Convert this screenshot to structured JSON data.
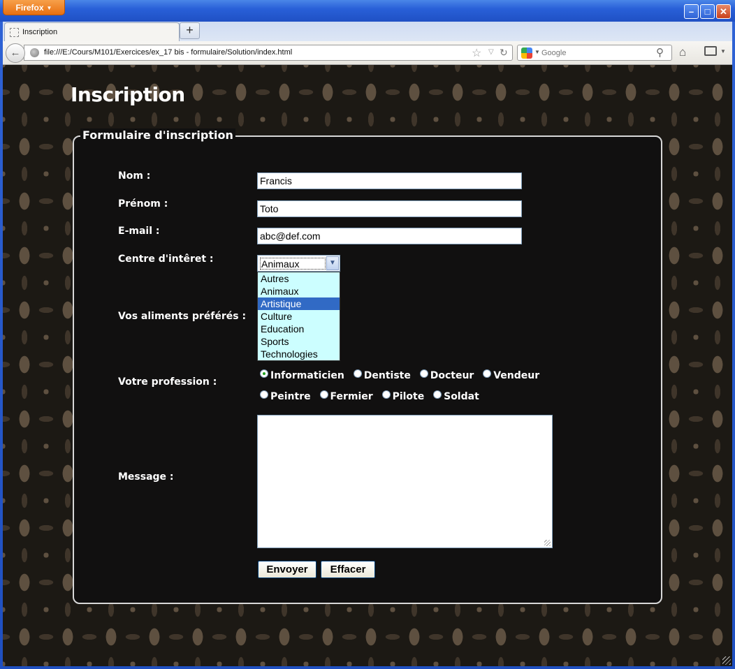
{
  "browser": {
    "app_button": "Firefox",
    "tab_title": "Inscription",
    "new_tab": "+",
    "url": "file:///E:/Cours/M101/Exercices/ex_17 bis - formulaire/Solution/index.html",
    "search_placeholder": "Google"
  },
  "page": {
    "title": "Inscription",
    "legend": "Formulaire d'inscription"
  },
  "form": {
    "nom_label": "Nom :",
    "nom_value": "Francis",
    "prenom_label": "Prénom :",
    "prenom_value": "Toto",
    "email_label": "E-mail :",
    "email_value": "abc@def.com",
    "interet_label": "Centre d'intêret :",
    "interet_selected": "Animaux",
    "interet_options": [
      "Autres",
      "Animaux",
      "Artistique",
      "Culture",
      "Education",
      "Sports",
      "Technologies"
    ],
    "interet_highlighted": "Artistique",
    "aliments_label": "Vos aliments préférés :",
    "profession_label": "Votre profession :",
    "professions_row1": [
      "Informaticien",
      "Dentiste",
      "Docteur",
      "Vendeur"
    ],
    "professions_row2": [
      "Peintre",
      "Fermier",
      "Pilote",
      "Soldat"
    ],
    "profession_checked": "Informaticien",
    "message_label": "Message :",
    "submit_label": "Envoyer",
    "reset_label": "Effacer"
  }
}
